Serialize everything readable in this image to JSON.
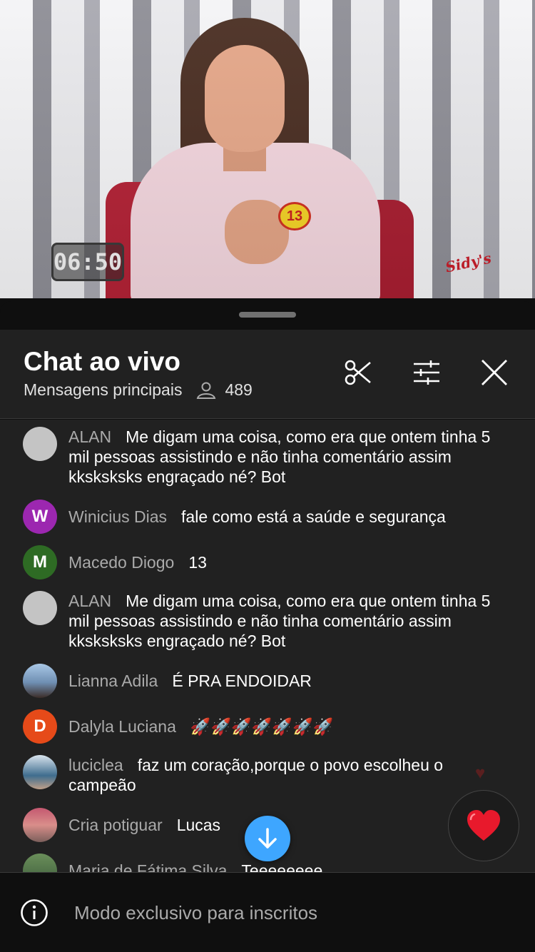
{
  "video": {
    "timer": "06:50",
    "badge_number": "13",
    "channel_logo": "Sidy's"
  },
  "chat": {
    "title": "Chat ao vivo",
    "subtitle": "Mensagens principais",
    "viewer_count": "489",
    "icons": {
      "clip": "scissors-icon",
      "filter": "tune-icon",
      "close": "close-icon",
      "viewers": "person-icon"
    },
    "messages": [
      {
        "author": "ALAN",
        "text": "Me digam uma coisa, como era que ontem tinha 5 mil pessoas assistindo e não tinha comentário assim kksksksks engraçado né? Bot",
        "avatar_letter": "",
        "avatar_color": "#c4c4c4"
      },
      {
        "author": "Winicius Dias",
        "text": "fale como está a saúde e segurança",
        "avatar_letter": "W",
        "avatar_color": "#9c27b0"
      },
      {
        "author": "Macedo Diogo",
        "text": "13",
        "avatar_letter": "M",
        "avatar_color": "#2e6b24"
      },
      {
        "author": "ALAN",
        "text": "Me digam uma coisa, como era que ontem tinha 5 mil pessoas assistindo e não tinha comentário assim kksksksks engraçado né? Bot",
        "avatar_letter": "",
        "avatar_color": "#c4c4c4"
      },
      {
        "author": "Lianna Adila",
        "text": "É PRA ENDOIDAR",
        "avatar_letter": "",
        "avatar_color": ""
      },
      {
        "author": "Dalyla Luciana",
        "text": "🚀🚀🚀🚀🚀🚀🚀",
        "avatar_letter": "D",
        "avatar_color": "#e64a19"
      },
      {
        "author": "luciclea",
        "text": "faz um coração,porque o povo escolheu o campeão",
        "avatar_letter": "",
        "avatar_color": ""
      },
      {
        "author": "Cria potiguar",
        "text": "Lucas",
        "avatar_letter": "",
        "avatar_color": ""
      },
      {
        "author": "Maria de Fátima Silva",
        "text": "Teeeeeeee",
        "avatar_letter": "",
        "avatar_color": ""
      }
    ],
    "footer_text": "Modo exclusivo para inscritos"
  }
}
